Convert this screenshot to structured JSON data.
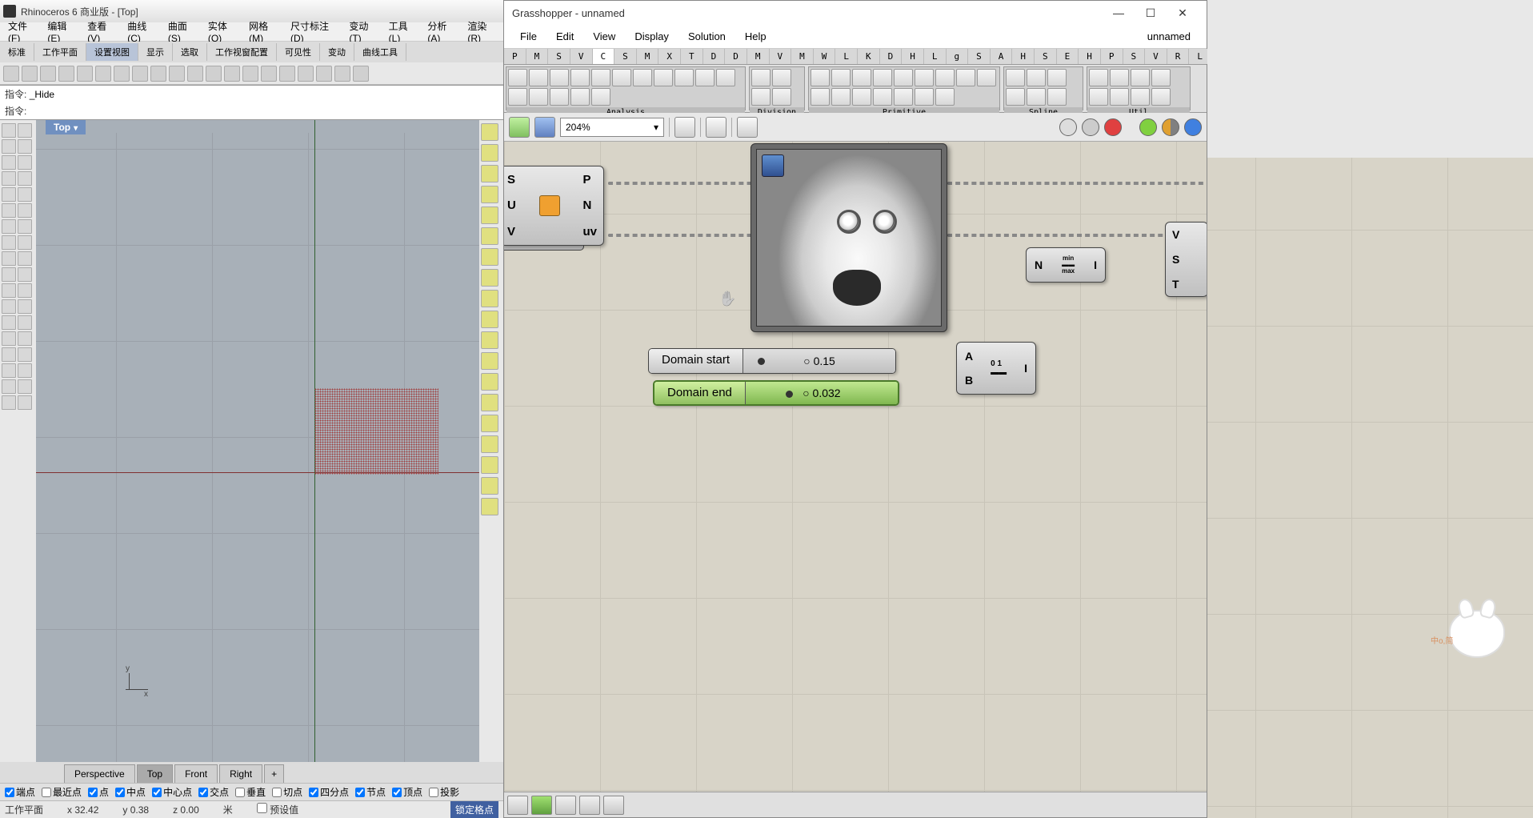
{
  "rhino": {
    "title": "Rhinoceros 6 商业版 - [Top]",
    "menu": [
      "文件(F)",
      "编辑(E)",
      "查看(V)",
      "曲线(C)",
      "曲面(S)",
      "实体(O)",
      "网格(M)",
      "尺寸标注(D)",
      "变动(T)",
      "工具(L)",
      "分析(A)",
      "渲染(R)"
    ],
    "tabs": [
      "标准",
      "工作平面",
      "设置视图",
      "显示",
      "选取",
      "工作视窗配置",
      "可见性",
      "变动",
      "曲线工具"
    ],
    "tabs_active": 2,
    "cmd_prev_label": "指令:",
    "cmd_prev": "_Hide",
    "cmd_label": "指令:",
    "viewport": "Top",
    "viewtabs": [
      "Perspective",
      "Top",
      "Front",
      "Right"
    ],
    "viewtabs_active": 1,
    "osnap": [
      {
        "label": "端点",
        "checked": true
      },
      {
        "label": "最近点",
        "checked": false
      },
      {
        "label": "点",
        "checked": true
      },
      {
        "label": "中点",
        "checked": true
      },
      {
        "label": "中心点",
        "checked": true
      },
      {
        "label": "交点",
        "checked": true
      },
      {
        "label": "垂直",
        "checked": false
      },
      {
        "label": "切点",
        "checked": false
      },
      {
        "label": "四分点",
        "checked": true
      },
      {
        "label": "节点",
        "checked": true
      },
      {
        "label": "顶点",
        "checked": true
      },
      {
        "label": "投影",
        "checked": false
      }
    ],
    "status": {
      "plane": "工作平面",
      "x": "x 32.42",
      "y": "y 0.38",
      "z": "z 0.00",
      "unit": "米",
      "preset_label": "预设值",
      "lock": "锁定格点"
    },
    "ucs": {
      "x": "x",
      "y": "y"
    }
  },
  "gh": {
    "title": "Grasshopper - unnamed",
    "doc": "unnamed",
    "menu": [
      "File",
      "Edit",
      "View",
      "Display",
      "Solution",
      "Help"
    ],
    "cat_tabs": [
      "P",
      "M",
      "S",
      "V",
      "C",
      "S",
      "M",
      "X",
      "T",
      "D",
      "D",
      "M",
      "V",
      "M",
      "W",
      "L",
      "K",
      "D",
      "H",
      "L",
      "g",
      "S",
      "A",
      "H",
      "S",
      "E",
      "H",
      "P",
      "S",
      "V",
      "R",
      "L"
    ],
    "cat_active": 4,
    "panels": [
      "Analysis",
      "Division",
      "Primitive",
      "Spline",
      "Util"
    ],
    "zoom": "204%",
    "nodes": {
      "eval": {
        "inputs": [
          "S",
          "U",
          "V"
        ],
        "outputs": [
          "P",
          "N",
          "uv"
        ]
      },
      "slider1": {
        "label": "Domain start",
        "value": "0.15",
        "grip_pct": 11
      },
      "slider2": {
        "label": "Domain end",
        "value": "0.032",
        "grip_pct": 28
      },
      "bounds": {
        "inputs": [
          "N"
        ],
        "outputs": [
          "I"
        ],
        "label_min": "min",
        "label_max": "max"
      },
      "construct": {
        "inputs": [
          "A",
          "B"
        ],
        "outputs": [
          "I"
        ]
      },
      "right": {
        "inputs": [
          "V",
          "S",
          "T"
        ]
      }
    },
    "mascot_text": "中o,简"
  }
}
